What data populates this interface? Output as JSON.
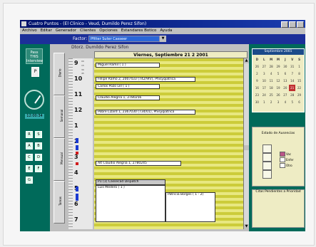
{
  "window": {
    "title": "Cuatro Puntos - (El Clinico - Veud, Dumildo Perez Sifon)",
    "min": "_",
    "max": "□",
    "close": "x"
  },
  "menu": [
    "Archivo",
    "Editar",
    "Generador",
    "Clientes",
    "Opciones",
    "Estandares Botico",
    "Ayuda"
  ],
  "toolbar": {
    "label": "Factor:",
    "select_value": "Pfilter Suter Casseer",
    "drop_arrow": "▼"
  },
  "sidebar": {
    "button1": "Pass THIS Interview",
    "small": "P",
    "time": "12:00:34",
    "squares": [
      "R",
      "S",
      "A",
      "B",
      "C",
      "D",
      "E",
      "F",
      "G"
    ]
  },
  "main": {
    "header": "Dtorz. Dumildo Perez Sifon",
    "day_title": "Viernes, Septiembre 21 2 2001",
    "tabs": [
      "Diario",
      "Semanal",
      "Mensual",
      "Tareas"
    ],
    "hours": [
      "9",
      "10",
      "11",
      "12",
      "1",
      "2",
      "3",
      "4",
      "5",
      "6",
      "7"
    ],
    "minutes": [
      "00",
      "15",
      "30",
      "45"
    ],
    "appointments": [
      "Miguel Ramil ( 1 )",
      "Felipe Ramo 2, 2007433 (742/9hr), Phisyqiatrica",
      "Carlos Pozo Lel ( 1 )",
      "Claudio Alegria 1, 2780256",
      "Pobre Lizard 1, 2367030 (734/01), Phisyqiatrica",
      "Alt Claudio Alegria 1, 2780245",
      "P1 (1) Cassecad Dispatch",
      "Luis Medero ( 1 )",
      "Patricia Borges ( 1 - 2)"
    ]
  },
  "calendar": {
    "title": "Septiembre 2001",
    "weekdays": [
      "D",
      "L",
      "M",
      "M",
      "J",
      "V",
      "S"
    ],
    "days": [
      "26",
      "27",
      "28",
      "29",
      "30",
      "31",
      "1",
      "2",
      "3",
      "4",
      "5",
      "6",
      "7",
      "8",
      "9",
      "10",
      "11",
      "12",
      "13",
      "14",
      "15",
      "16",
      "17",
      "18",
      "19",
      "20",
      "21",
      "22",
      "23",
      "24",
      "25",
      "26",
      "27",
      "28",
      "29",
      "30",
      "1",
      "2",
      "3",
      "4",
      "5",
      "6"
    ]
  },
  "panel2": {
    "title": "Estado de Ausencias",
    "checks": [
      "Vac",
      "Enfer",
      "Otro"
    ]
  },
  "panel3": {
    "title": "Citas Pendientes a Prioridad"
  },
  "colors": {
    "sidebar": "#006a5a",
    "toolbar": "#1c2f99",
    "titlebar": "#00116a",
    "agenda": "#cccc3a"
  }
}
